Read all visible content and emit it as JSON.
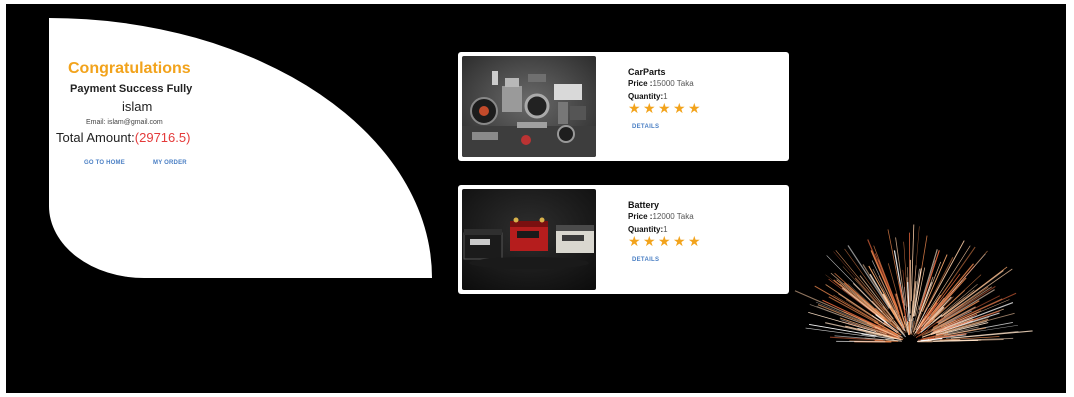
{
  "success": {
    "title": "Congratulations",
    "message": "Payment Success Fully",
    "user_name": "islam",
    "email": "Email: islam@gmail.com",
    "total_label": "Total Amount:",
    "total_value": "(29716.5)",
    "home_button": "GO TO HOME",
    "order_button": "MY ORDER"
  },
  "products": [
    {
      "name": "CarParts",
      "price_label": "Price :",
      "price_value": "15000 Taka",
      "quantity_label": "Quantity:",
      "quantity_value": "1",
      "rating": 5,
      "details_label": "DETAILS",
      "image_icon": "car-parts-photo"
    },
    {
      "name": "Battery",
      "price_label": "Price :",
      "price_value": "12000 Taka",
      "quantity_label": "Quantity:",
      "quantity_value": "1",
      "rating": 5,
      "details_label": "DETAILS",
      "image_icon": "battery-photo"
    }
  ],
  "colors": {
    "accent": "#f2a31c",
    "amount": "#e43a3a",
    "link": "#4a7fc4",
    "background": "#000000"
  }
}
